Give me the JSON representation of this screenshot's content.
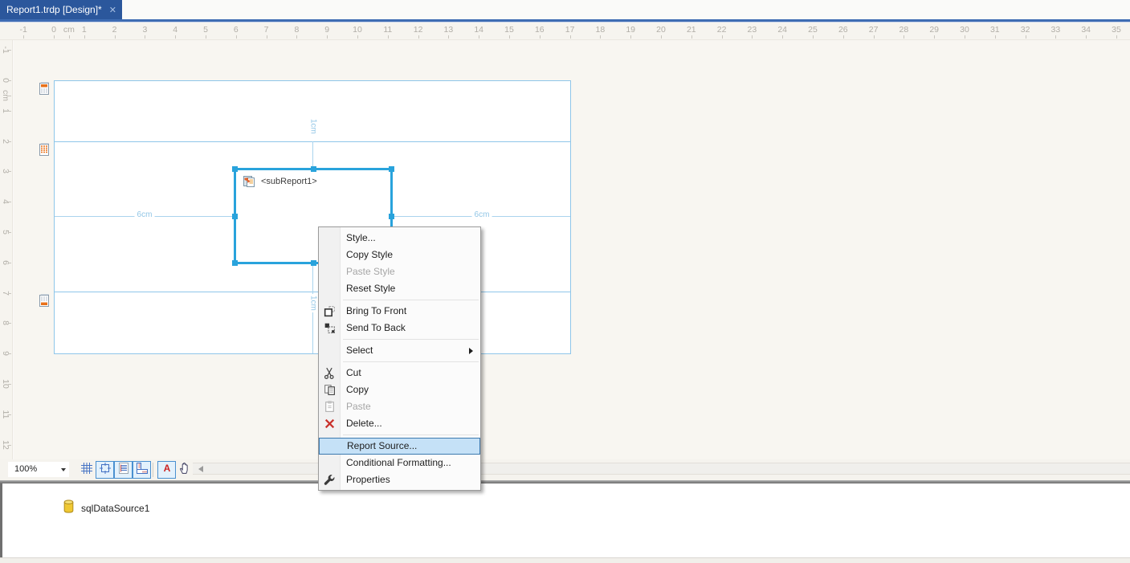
{
  "window": {
    "tab_title": "Report1.trdp [Design]*",
    "tab_close_glyph": "✕"
  },
  "rulers": {
    "unit_label": "cm",
    "horizontal_labels": [
      "-1",
      "0",
      "cm",
      "1",
      "2",
      "3",
      "4",
      "5",
      "6",
      "7",
      "8",
      "9",
      "10",
      "11",
      "12",
      "13",
      "14",
      "15",
      "16",
      "17",
      "18",
      "19",
      "20",
      "21",
      "22",
      "23",
      "24",
      "25",
      "26",
      "27",
      "28",
      "29",
      "30",
      "31",
      "32",
      "33",
      "34",
      "35"
    ],
    "vertical_labels": [
      "-1",
      "0",
      "cm",
      "1",
      "2",
      "3",
      "4",
      "5",
      "6",
      "7",
      "8",
      "9",
      "10",
      "11",
      "12"
    ]
  },
  "design": {
    "sections": [
      {
        "name": "page-header",
        "icon": "page-header-icon"
      },
      {
        "name": "detail",
        "icon": "detail-icon"
      },
      {
        "name": "page-footer",
        "icon": "page-footer-icon"
      }
    ],
    "subreport": {
      "label": "<subReport1>",
      "icon": "subreport-icon"
    },
    "measurements": {
      "top": "1cm",
      "bottom": "1cm",
      "left": "6cm",
      "right": "6cm"
    }
  },
  "context_menu": {
    "items": [
      {
        "label": "Style...",
        "enabled": true
      },
      {
        "label": "Copy Style",
        "enabled": true
      },
      {
        "label": "Paste Style",
        "enabled": false
      },
      {
        "label": "Reset Style",
        "enabled": true
      },
      {
        "separator": true
      },
      {
        "label": "Bring To Front",
        "icon": "bring-to-front-icon",
        "enabled": true
      },
      {
        "label": "Send To Back",
        "icon": "send-to-back-icon",
        "enabled": true
      },
      {
        "separator": true
      },
      {
        "label": "Select",
        "submenu": true,
        "enabled": true
      },
      {
        "separator": true
      },
      {
        "label": "Cut",
        "icon": "cut-icon",
        "enabled": true
      },
      {
        "label": "Copy",
        "icon": "copy-icon",
        "enabled": true
      },
      {
        "label": "Paste",
        "icon": "paste-icon",
        "enabled": false
      },
      {
        "label": "Delete...",
        "icon": "delete-icon",
        "enabled": true
      },
      {
        "separator": true
      },
      {
        "label": "Report Source...",
        "highlighted": true,
        "enabled": true
      },
      {
        "label": "Conditional Formatting...",
        "enabled": true
      },
      {
        "label": "Properties",
        "icon": "properties-icon",
        "enabled": true
      }
    ]
  },
  "toolbar": {
    "zoom_value": "100%",
    "buttons": [
      {
        "name": "show-grid",
        "icon": "grid-icon",
        "toggled": false
      },
      {
        "name": "snap-to-grid",
        "icon": "snap-grid-icon",
        "toggled": true
      },
      {
        "name": "snap-lines",
        "icon": "page-lines-icon",
        "toggled": true
      },
      {
        "name": "show-rulers",
        "icon": "ruler-icon",
        "toggled": true
      },
      {
        "separator": true
      },
      {
        "name": "font-preview",
        "icon": "font-a-icon",
        "toggled": true
      },
      {
        "name": "pan-tool",
        "icon": "hand-icon",
        "toggled": false
      }
    ]
  },
  "data_explorer": {
    "items": [
      {
        "label": "sqlDataSource1",
        "icon": "database-icon"
      }
    ]
  },
  "colors": {
    "tab_accent": "#2B579C",
    "tab_underline": "#3E6CB3",
    "selection": "#29A3DC",
    "section_border": "#8FC6E9",
    "measurement": "#92C6E6",
    "menu_highlight_bg": "#C5E1F7",
    "menu_highlight_border": "#3C79AE",
    "datasource_icon": "#EFC832"
  }
}
